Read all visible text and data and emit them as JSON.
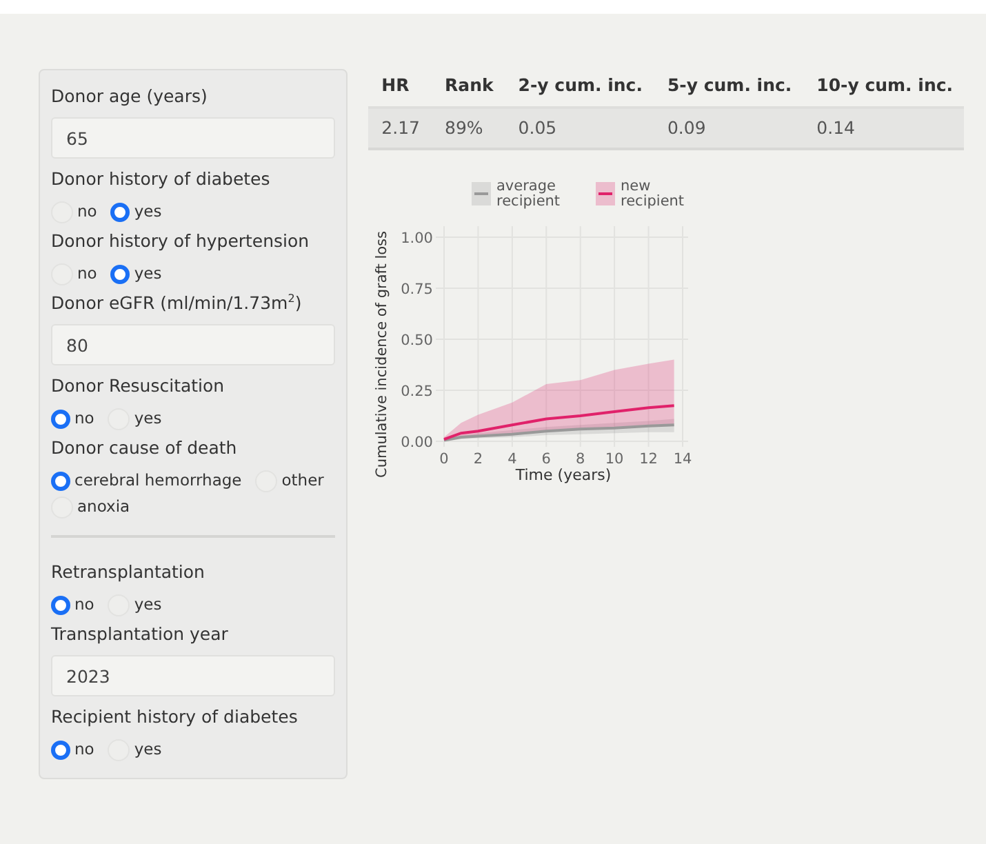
{
  "inputs": [
    {
      "kind": "number",
      "label": "Donor age (years)",
      "value": "65"
    },
    {
      "kind": "radio",
      "label": "Donor history of diabetes",
      "options": [
        {
          "label": "no",
          "selected": false
        },
        {
          "label": "yes",
          "selected": true
        }
      ]
    },
    {
      "kind": "radio",
      "label": "Donor history of hypertension",
      "options": [
        {
          "label": "no",
          "selected": false
        },
        {
          "label": "yes",
          "selected": true
        }
      ]
    },
    {
      "kind": "number",
      "label": "Donor eGFR (ml/min/1.73m$^{2}$)",
      "value": "80"
    },
    {
      "kind": "radio",
      "label": "Donor Resuscitation",
      "options": [
        {
          "label": "no",
          "selected": true
        },
        {
          "label": "yes",
          "selected": false
        }
      ]
    },
    {
      "kind": "radio",
      "label": "Donor cause of death",
      "options": [
        {
          "label": "cerebral hemorrhage",
          "selected": true
        },
        {
          "label": "other",
          "selected": false
        },
        {
          "label": "anoxia",
          "selected": false
        }
      ]
    },
    {
      "kind": "divider"
    },
    {
      "kind": "radio",
      "label": "Retransplantation",
      "options": [
        {
          "label": "no",
          "selected": true
        },
        {
          "label": "yes",
          "selected": false
        }
      ]
    },
    {
      "kind": "number",
      "label": "Transplantation year",
      "value": "2023"
    },
    {
      "kind": "radio",
      "label": "Recipient history of diabetes",
      "options": [
        {
          "label": "no",
          "selected": true
        },
        {
          "label": "yes",
          "selected": false
        }
      ]
    }
  ],
  "table": {
    "columns": [
      "HR",
      "Rank",
      "2-y cum. inc.",
      "5-y cum. inc.",
      "10-y cum. inc."
    ],
    "rows": [
      [
        "2.17",
        "89%",
        "0.05",
        "0.09",
        "0.14"
      ]
    ]
  },
  "chart": {
    "chart_data": {
      "type": "line",
      "xlabel": "Time (years)",
      "ylabel": "Cumulative incidence of graft loss",
      "x": [
        0,
        1,
        2,
        4,
        6,
        8,
        10,
        12,
        13.5
      ],
      "series": [
        {
          "name": "average\nrecipient",
          "color": "#999999",
          "values": [
            0.005,
            0.02,
            0.025,
            0.035,
            0.05,
            0.06,
            0.065,
            0.075,
            0.08
          ],
          "lower": [
            0,
            0.01,
            0.015,
            0.02,
            0.03,
            0.035,
            0.04,
            0.045,
            0.045
          ],
          "upper": [
            0.01,
            0.03,
            0.04,
            0.055,
            0.07,
            0.08,
            0.09,
            0.1,
            0.11
          ]
        },
        {
          "name": "new\nrecipient",
          "color": "#e0226a",
          "values": [
            0.01,
            0.04,
            0.05,
            0.08,
            0.11,
            0.125,
            0.145,
            0.165,
            0.175
          ],
          "lower": [
            0,
            0.015,
            0.02,
            0.035,
            0.05,
            0.06,
            0.07,
            0.08,
            0.085
          ],
          "upper": [
            0.02,
            0.09,
            0.13,
            0.19,
            0.28,
            0.3,
            0.35,
            0.38,
            0.4
          ]
        }
      ],
      "grid": true,
      "legend": true,
      "xlim": [
        0,
        14
      ],
      "ylim": [
        0,
        1
      ],
      "xticks": [
        0,
        2,
        4,
        6,
        8,
        10,
        12,
        14
      ],
      "yticks": [
        {
          "value": 0,
          "label": "0.00"
        },
        {
          "value": 0.25,
          "label": "0.25"
        },
        {
          "value": 0.5,
          "label": "0.50"
        },
        {
          "value": 0.75,
          "label": "0.75"
        },
        {
          "value": 1,
          "label": "1.00"
        }
      ]
    }
  }
}
